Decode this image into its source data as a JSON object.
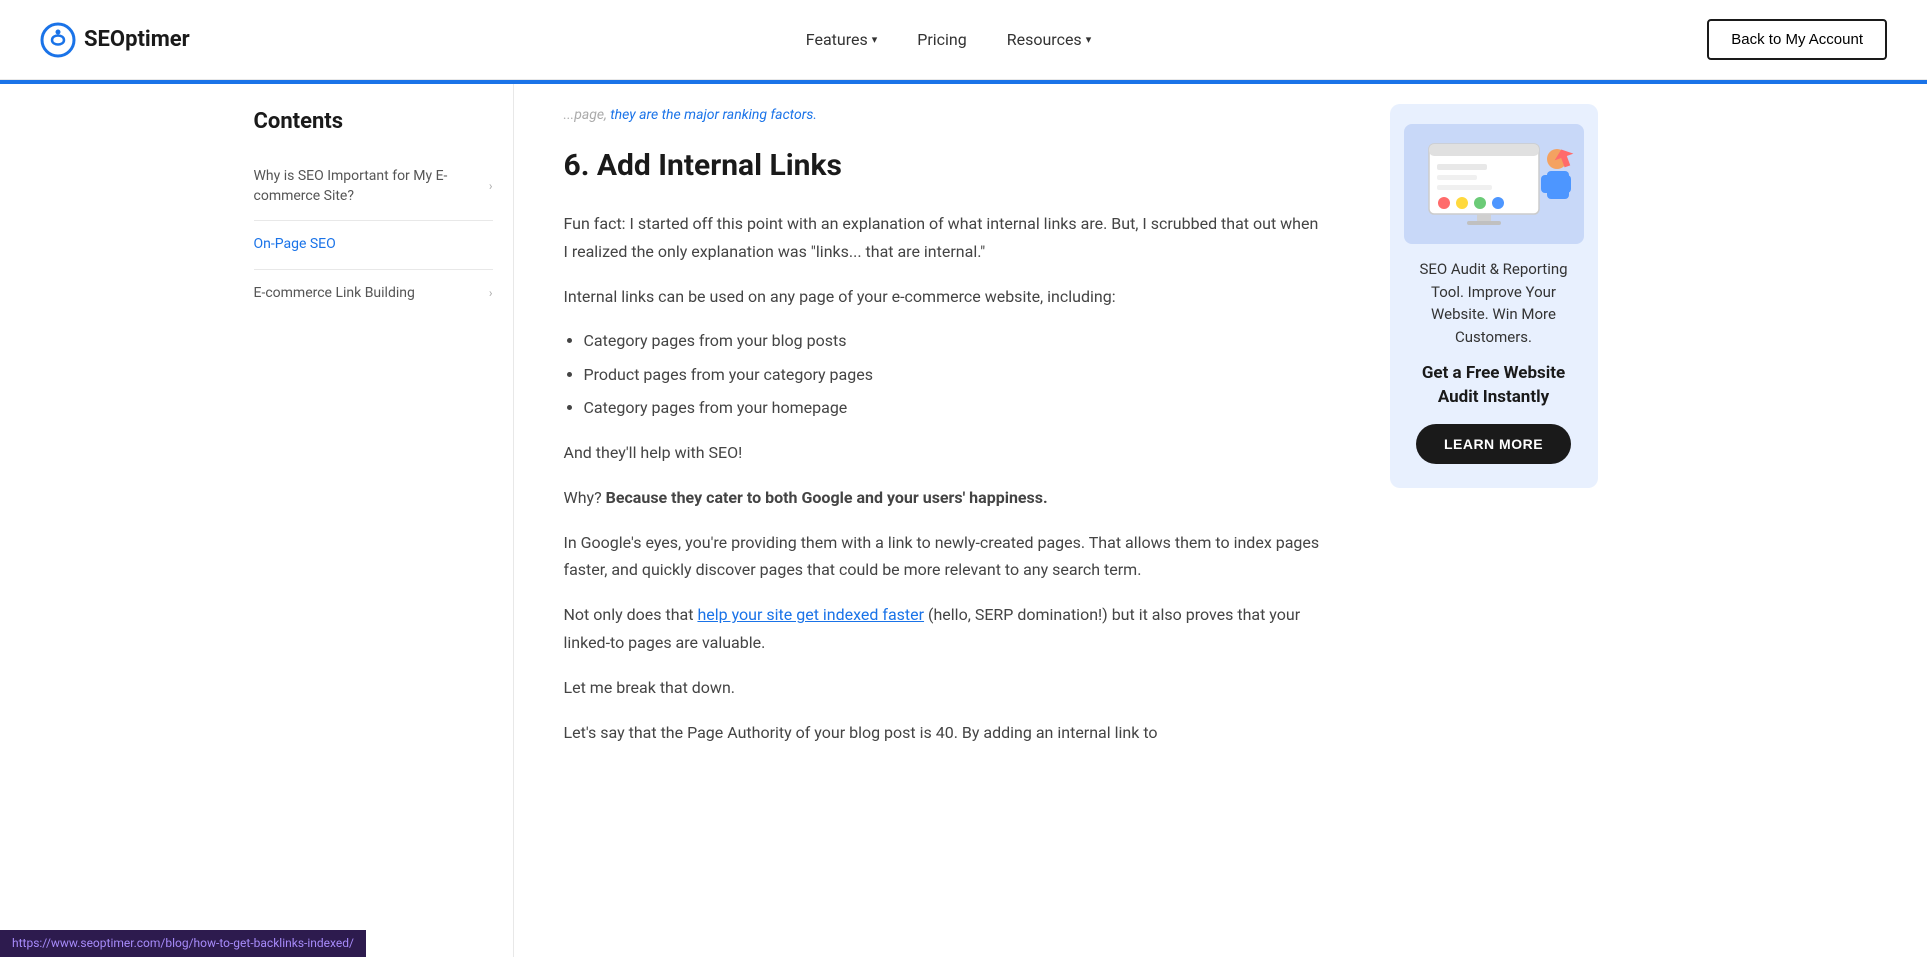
{
  "header": {
    "logo_text": "SEOptimer",
    "nav_items": [
      {
        "label": "Features",
        "has_dropdown": true
      },
      {
        "label": "Pricing",
        "has_dropdown": false
      },
      {
        "label": "Resources",
        "has_dropdown": true
      }
    ],
    "back_button_label": "Back to My Account"
  },
  "sidebar": {
    "title": "Contents",
    "items": [
      {
        "label": "Why is SEO Important for My E-commerce Site?",
        "active": false,
        "has_arrow": true
      },
      {
        "label": "On-Page SEO",
        "active": true,
        "has_arrow": false
      },
      {
        "label": "E-commerce Link Building",
        "active": false,
        "has_arrow": true
      }
    ]
  },
  "main": {
    "faded_top_text": "page, they are the major ranking factors.",
    "section_number": "6.",
    "section_title": "Add Internal Links",
    "paragraphs": [
      "Fun fact: I started off this point with an explanation of what internal links are. But, I scrubbed that out when I realized the only explanation was \"links... that are internal.\"",
      "Internal links can be used on any page of your e-commerce website, including:"
    ],
    "bullet_items": [
      "Category pages from your blog posts",
      "Product pages from your category pages",
      "Category pages from your homepage"
    ],
    "para_after_bullets": "And they'll help with SEO!",
    "para_why": "Why?",
    "para_why_bold": "Because they cater to both Google and your users' happiness.",
    "para_google": "In Google's eyes, you're providing them with a link to newly-created pages. That allows them to index pages faster, and quickly discover pages that could be more relevant to any search term.",
    "para_not_only_before_link": "Not only does that",
    "para_link_text": "help your site get indexed faster",
    "para_not_only_after_link": "(hello, SERP domination!) but it also proves that your linked-to pages are valuable.",
    "para_break": "Let me break that down.",
    "para_lets_say": "Let's say that the Page Authority of your blog post is 40. By adding an internal link to"
  },
  "cta_panel": {
    "description_text": "SEO Audit & Reporting Tool. Improve Your Website. Win More Customers.",
    "headline": "Get a Free Website Audit Instantly",
    "button_label": "LEARN MORE"
  },
  "status_bar": {
    "url": "https://www.seoptimer.com/blog/how-to-get-backlinks-indexed/"
  }
}
